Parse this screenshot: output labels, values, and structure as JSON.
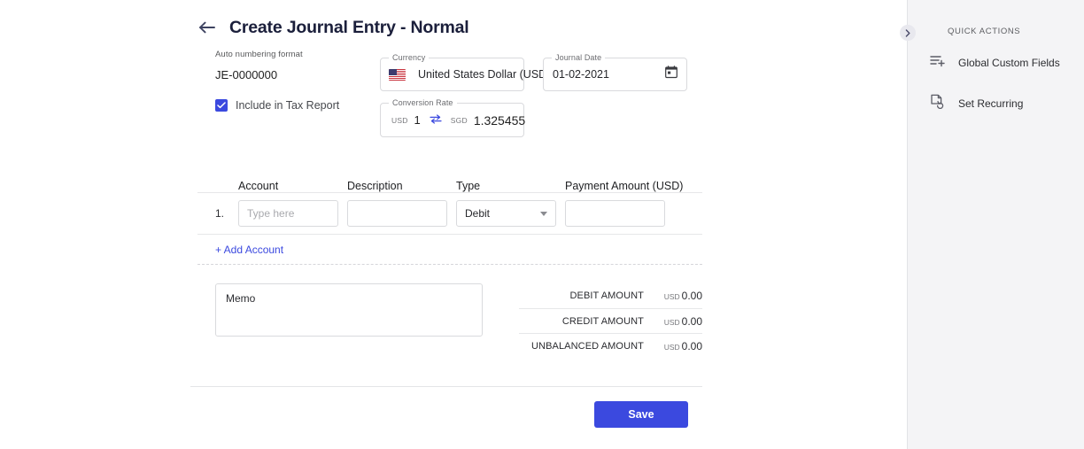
{
  "header": {
    "back_icon": "back-arrow-icon",
    "title": "Create Journal Entry - Normal"
  },
  "form": {
    "auto_numbering": {
      "label": "Auto numbering format",
      "value": "JE-0000000"
    },
    "tax_report": {
      "label": "Include in Tax Report",
      "checked": true
    },
    "currency": {
      "legend": "Currency",
      "value": "United States Dollar (USD)",
      "flag_icon": "us-flag-icon",
      "caret_icon": "chevron-down-icon"
    },
    "journal_date": {
      "legend": "Journal Date",
      "value": "01-02-2021",
      "icon": "calendar-icon"
    },
    "conversion_rate": {
      "legend": "Conversion Rate",
      "from_currency": "USD",
      "from_value": "1",
      "swap_icon": "swap-arrows-icon",
      "to_currency": "SGD",
      "to_value": "1.325455"
    }
  },
  "table": {
    "columns": [
      "Account",
      "Description",
      "Type",
      "Payment Amount (USD)"
    ],
    "rows": [
      {
        "index": "1.",
        "account_placeholder": "Type here",
        "account_value": "",
        "description_value": "",
        "type_value": "Debit",
        "type_caret": "chevron-down-icon",
        "amount_value": ""
      }
    ],
    "add_account_label": "+ Add Account"
  },
  "memo": {
    "value": "Memo"
  },
  "totals": [
    {
      "label": "DEBIT AMOUNT",
      "currency": "USD",
      "amount": "0.00"
    },
    {
      "label": "CREDIT AMOUNT",
      "currency": "USD",
      "amount": "0.00"
    },
    {
      "label": "UNBALANCED AMOUNT",
      "currency": "USD",
      "amount": "0.00"
    }
  ],
  "footer": {
    "save_label": "Save"
  },
  "sidebar": {
    "title": "QUICK ACTIONS",
    "toggle_icon": "chevron-right-icon",
    "items": [
      {
        "label": "Global Custom Fields",
        "icon": "list-add-icon"
      },
      {
        "label": "Set Recurring",
        "icon": "document-recurring-icon"
      }
    ]
  },
  "colors": {
    "accent": "#3b49df",
    "title": "#1b1f3b",
    "sidebar_bg": "#f4f4f6",
    "border": "#d9dadd"
  }
}
